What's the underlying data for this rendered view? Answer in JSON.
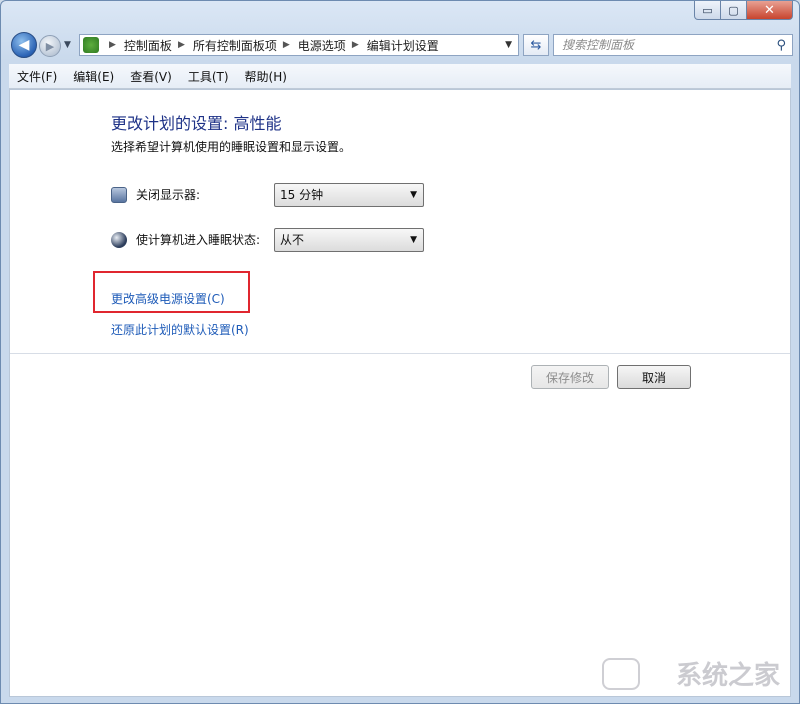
{
  "window": {
    "minimize": "▭",
    "maximize": "▢",
    "close": "✕"
  },
  "nav": {
    "back_icon": "arrow-left-icon",
    "breadcrumb": [
      "控制面板",
      "所有控制面板项",
      "电源选项",
      "编辑计划设置"
    ],
    "search_placeholder": "搜索控制面板"
  },
  "menu": [
    "文件(F)",
    "编辑(E)",
    "查看(V)",
    "工具(T)",
    "帮助(H)"
  ],
  "main": {
    "title": "更改计划的设置: 高性能",
    "subtitle": "选择希望计算机使用的睡眠设置和显示设置。",
    "display_label": "关闭显示器:",
    "display_value": "15 分钟",
    "sleep_label": "使计算机进入睡眠状态:",
    "sleep_value": "从不",
    "advanced_link": "更改高级电源设置(C)",
    "restore_link": "还原此计划的默认设置(R)",
    "save_button": "保存修改",
    "cancel_button": "取消"
  },
  "watermark": "系统之家",
  "colors": {
    "link": "#1e5bb8",
    "title": "#1e3287",
    "highlight": "#e0262f"
  }
}
